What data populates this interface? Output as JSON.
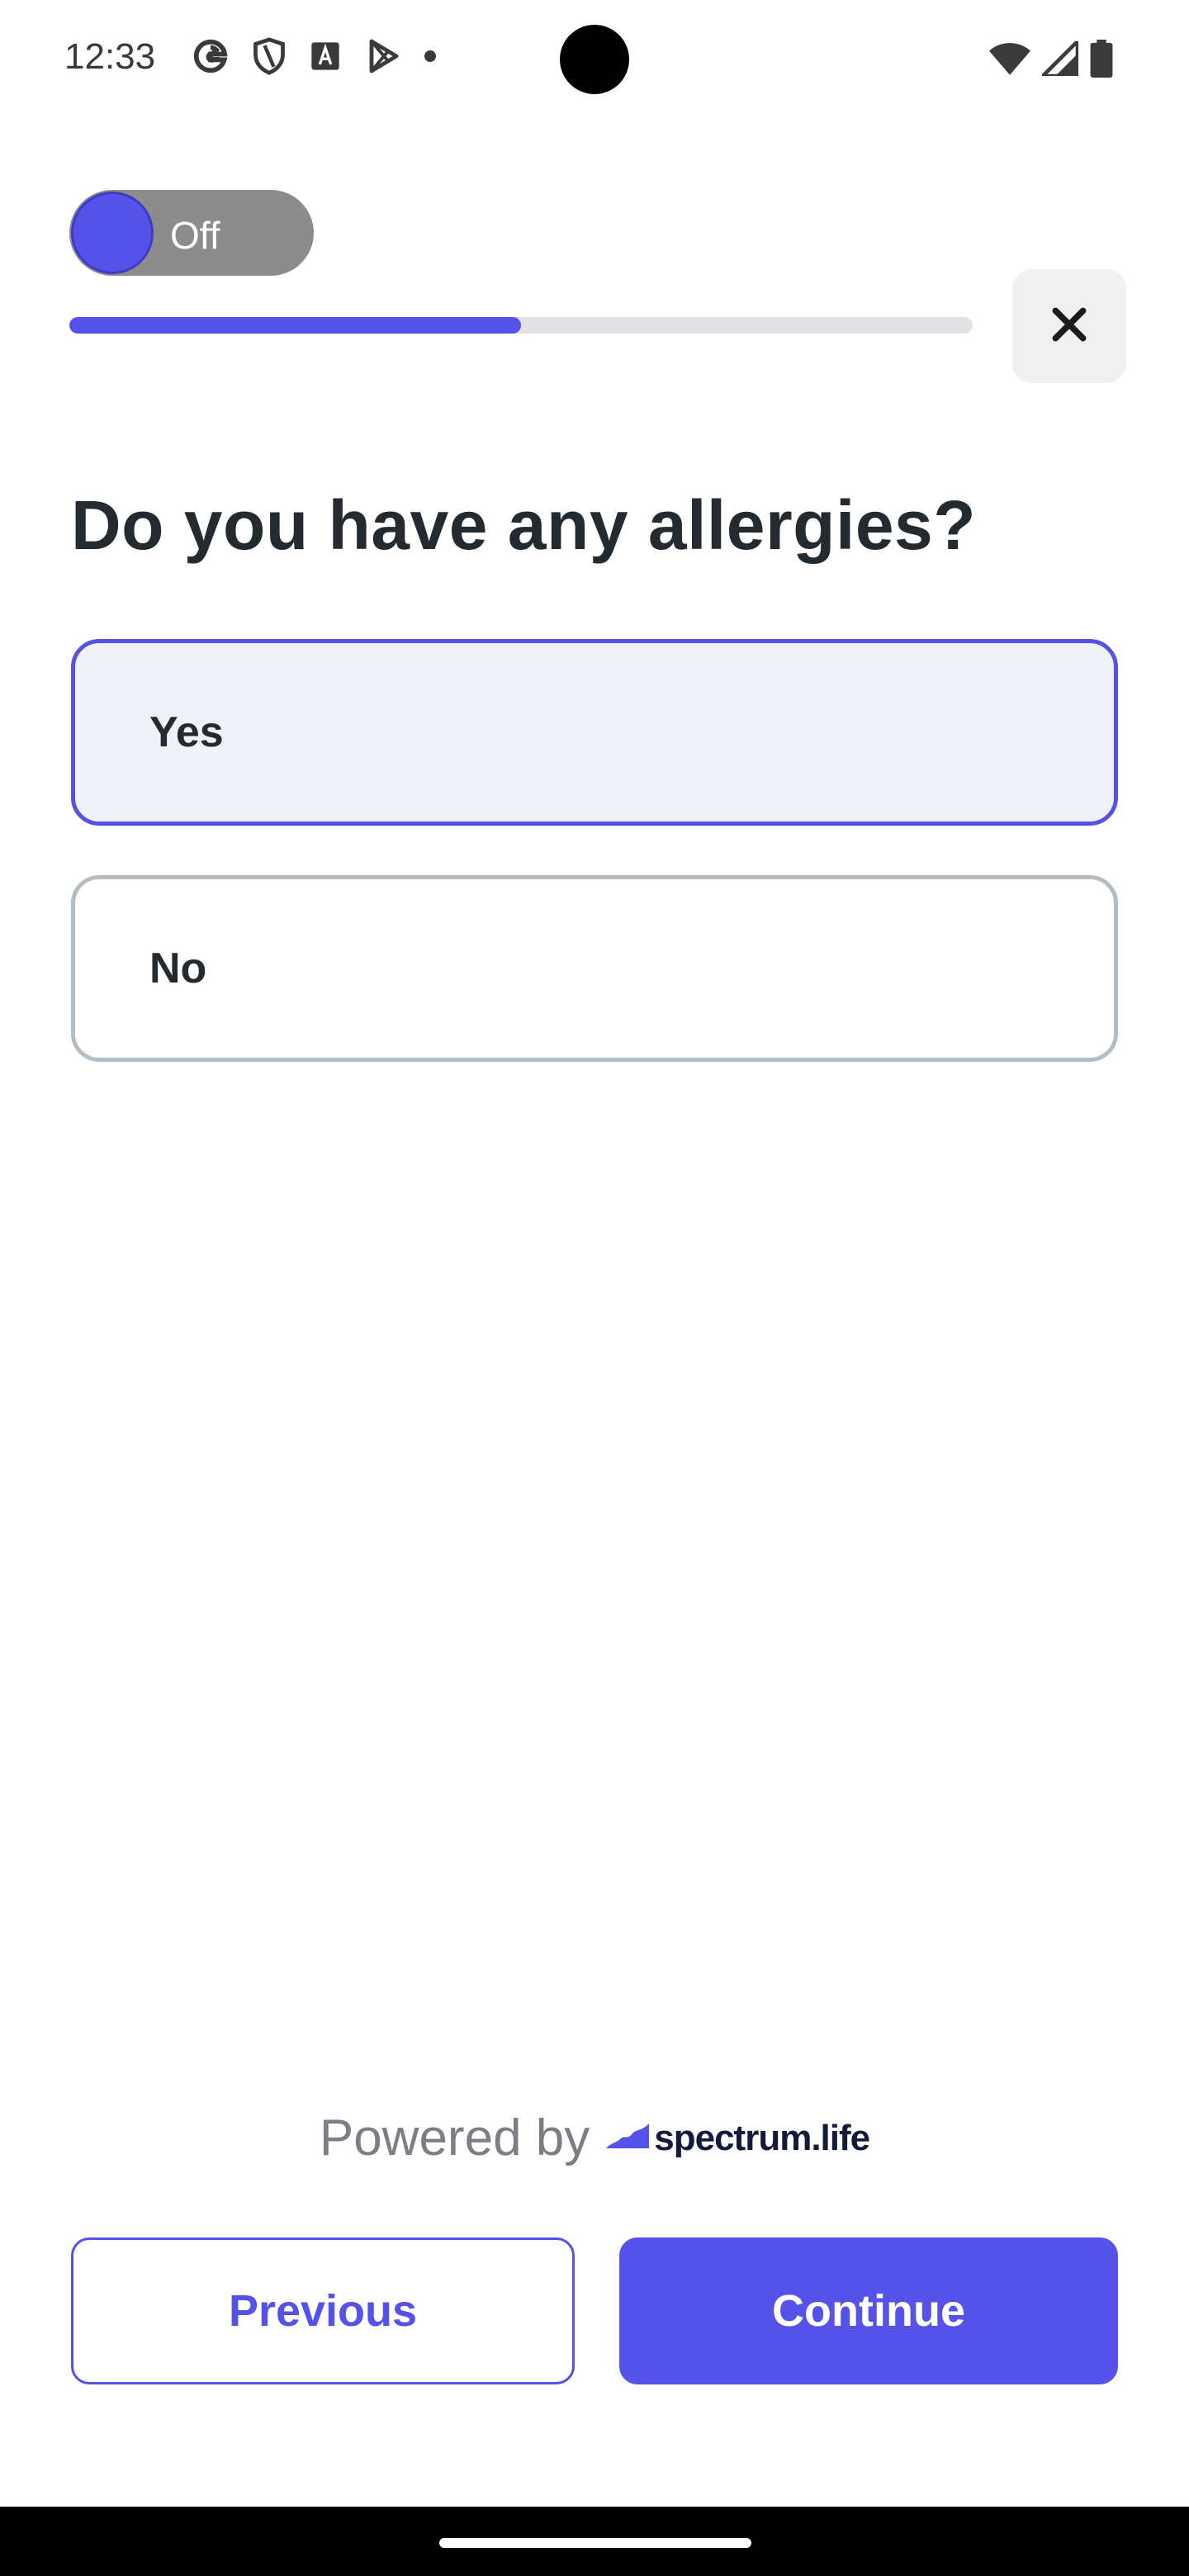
{
  "status_bar": {
    "time": "12:33",
    "left_icons": [
      "google-icon",
      "shield-icon",
      "text-a-icon",
      "play-store-icon",
      "dot-icon"
    ],
    "right_icons": [
      "wifi-icon",
      "signal-icon",
      "battery-icon"
    ]
  },
  "toggle": {
    "label": "Off",
    "state": false
  },
  "progress": {
    "fraction": 0.5
  },
  "close": {
    "icon": "close-icon"
  },
  "question": {
    "title": "Do you have any allergies?"
  },
  "options": [
    {
      "label": "Yes",
      "selected": true
    },
    {
      "label": "No",
      "selected": false
    }
  ],
  "footer": {
    "powered_text": "Powered by",
    "brand_name": "spectrum.life"
  },
  "buttons": {
    "previous_label": "Previous",
    "continue_label": "Continue"
  },
  "colors": {
    "accent": "#5452e8",
    "text": "#232a30",
    "border_unselected": "#b3bdc3",
    "selected_bg": "#f1f1f8"
  }
}
